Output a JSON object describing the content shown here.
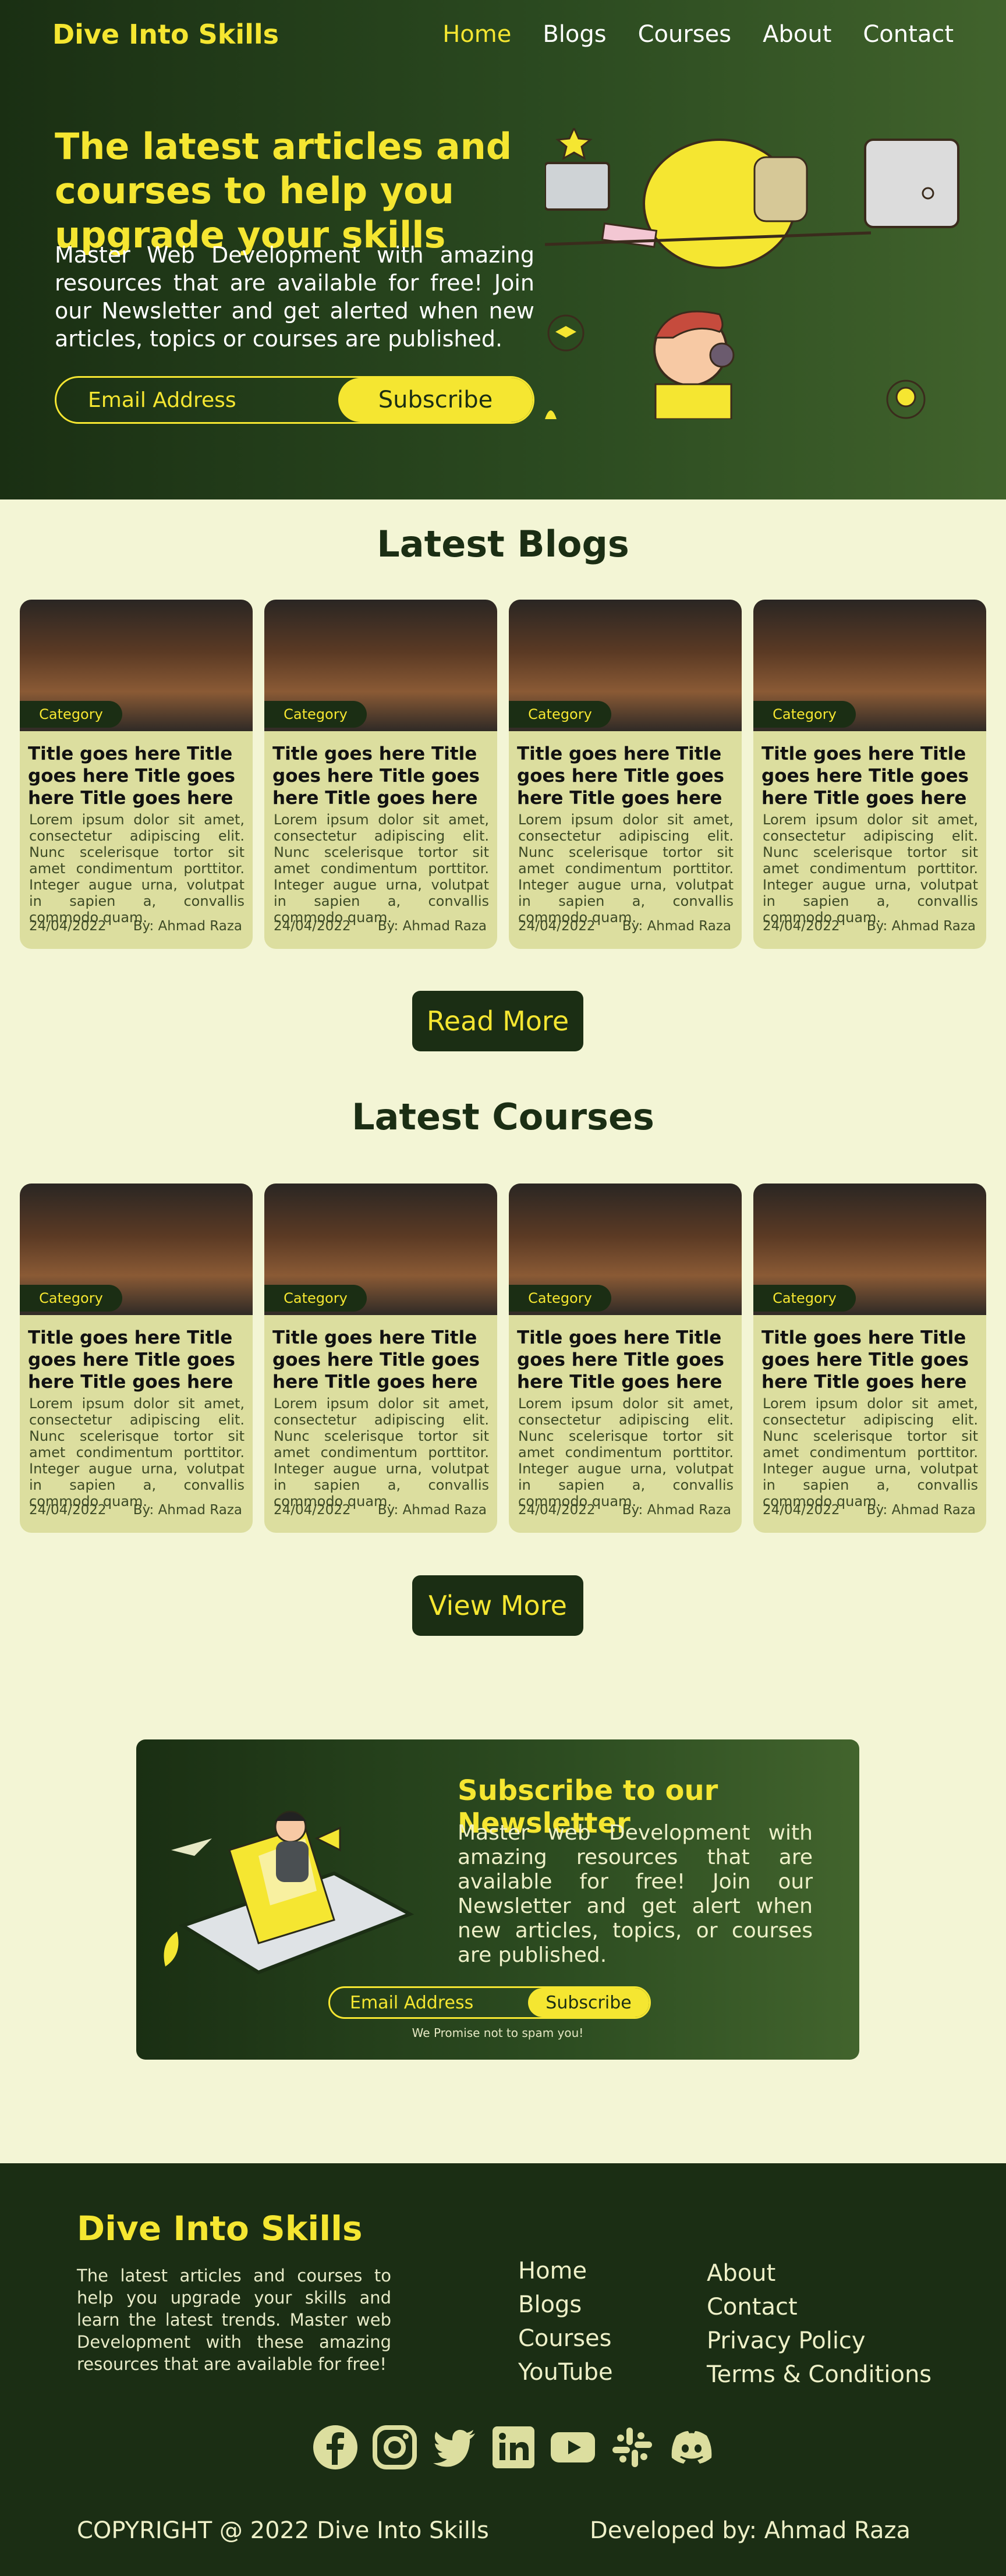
{
  "header": {
    "brand": "Dive Into Skills",
    "nav": [
      "Home",
      "Blogs",
      "Courses",
      "About",
      "Contact"
    ],
    "active_nav": "Home"
  },
  "hero": {
    "title": "The latest articles and courses to help you upgrade your skills",
    "description": "Master Web Development with amazing resources that are available for free! Join our Newsletter and get alerted when new articles, topics or courses are published.",
    "email_placeholder": "Email Address",
    "subscribe_label": "Subscribe"
  },
  "blogs": {
    "title": "Latest Blogs",
    "button": "Read More",
    "cards": [
      {
        "category": "Category",
        "title": "Title goes here Title goes here Title goes here Title goes here",
        "desc": "Lorem ipsum dolor sit amet, consectetur adipiscing elit. Nunc scelerisque tortor sit amet condimentum porttitor. Integer augue urna, volutpat in sapien a, convallis commodo quam.",
        "date": "24/04/2022",
        "author": "By: Ahmad Raza"
      },
      {
        "category": "Category",
        "title": "Title goes here Title goes here Title goes here Title goes here",
        "desc": "Lorem ipsum dolor sit amet, consectetur adipiscing elit. Nunc scelerisque tortor sit amet condimentum porttitor. Integer augue urna, volutpat in sapien a, convallis commodo quam.",
        "date": "24/04/2022",
        "author": "By: Ahmad Raza"
      },
      {
        "category": "Category",
        "title": "Title goes here Title goes here Title goes here Title goes here",
        "desc": "Lorem ipsum dolor sit amet, consectetur adipiscing elit. Nunc scelerisque tortor sit amet condimentum porttitor. Integer augue urna, volutpat in sapien a, convallis commodo quam.",
        "date": "24/04/2022",
        "author": "By: Ahmad Raza"
      },
      {
        "category": "Category",
        "title": "Title goes here Title goes here Title goes here Title goes here",
        "desc": "Lorem ipsum dolor sit amet, consectetur adipiscing elit. Nunc scelerisque tortor sit amet condimentum porttitor. Integer augue urna, volutpat in sapien a, convallis commodo quam.",
        "date": "24/04/2022",
        "author": "By: Ahmad Raza"
      }
    ]
  },
  "courses": {
    "title": "Latest Courses",
    "button": "View More",
    "cards": [
      {
        "category": "Category",
        "title": "Title goes here Title goes here Title goes here Title goes here",
        "desc": "Lorem ipsum dolor sit amet, consectetur adipiscing elit. Nunc scelerisque tortor sit amet condimentum porttitor. Integer augue urna, volutpat in sapien a, convallis commodo quam.",
        "date": "24/04/2022",
        "author": "By: Ahmad Raza"
      },
      {
        "category": "Category",
        "title": "Title goes here Title goes here Title goes here Title goes here",
        "desc": "Lorem ipsum dolor sit amet, consectetur adipiscing elit. Nunc scelerisque tortor sit amet condimentum porttitor. Integer augue urna, volutpat in sapien a, convallis commodo quam.",
        "date": "24/04/2022",
        "author": "By: Ahmad Raza"
      },
      {
        "category": "Category",
        "title": "Title goes here Title goes here Title goes here Title goes here",
        "desc": "Lorem ipsum dolor sit amet, consectetur adipiscing elit. Nunc scelerisque tortor sit amet condimentum porttitor. Integer augue urna, volutpat in sapien a, convallis commodo quam.",
        "date": "24/04/2022",
        "author": "By: Ahmad Raza"
      },
      {
        "category": "Category",
        "title": "Title goes here Title goes here Title goes here Title goes here",
        "desc": "Lorem ipsum dolor sit amet, consectetur adipiscing elit. Nunc scelerisque tortor sit amet condimentum porttitor. Integer augue urna, volutpat in sapien a, convallis commodo quam.",
        "date": "24/04/2022",
        "author": "By: Ahmad Raza"
      }
    ]
  },
  "newsletter": {
    "title": "Subscribe to our Newsletter",
    "description": "Master web Development with amazing resources that are available for free! Join our Newsletter and get alert when new articles, topics, or courses are published.",
    "email_placeholder": "Email Address",
    "subscribe_label": "Subscribe",
    "note": "We Promise not to spam you!"
  },
  "footer": {
    "brand": "Dive Into Skills",
    "description": "The latest articles and courses to help you upgrade your skills and learn the latest trends. Master web Development with these amazing resources that are available for free!",
    "links_col1": [
      "Home",
      "Blogs",
      "Courses",
      "YouTube"
    ],
    "links_col2": [
      "About",
      "Contact",
      "Privacy Policy",
      "Terms & Conditions"
    ],
    "socials": [
      "facebook-icon",
      "instagram-icon",
      "twitter-icon",
      "linkedin-icon",
      "youtube-icon",
      "slack-icon",
      "discord-icon"
    ],
    "copyright": "COPYRIGHT @ 2022 Dive Into Skills",
    "developer": "Developed by: Ahmad Raza"
  },
  "colors": {
    "accent": "#f5e631",
    "dark": "#1b2e14",
    "background": "#f3f5d5",
    "card": "#dcde9f"
  }
}
